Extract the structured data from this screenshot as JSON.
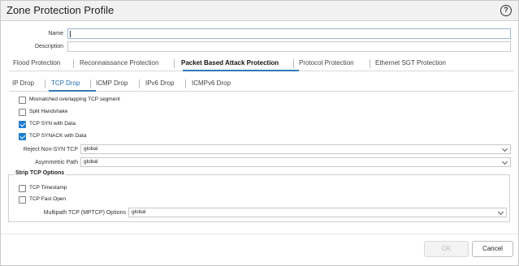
{
  "dialog": {
    "title": "Zone Protection Profile",
    "help_icon": "?"
  },
  "form": {
    "name_label": "Name",
    "name_value": "",
    "description_label": "Description",
    "description_value": ""
  },
  "main_tabs": [
    {
      "label": "Flood Protection",
      "active": false
    },
    {
      "label": "Reconnaissance Protection",
      "active": false
    },
    {
      "label": "Packet Based Attack Protection",
      "active": true
    },
    {
      "label": "Protocol Protection",
      "active": false
    },
    {
      "label": "Ethernet SGT Protection",
      "active": false
    }
  ],
  "sub_tabs": [
    {
      "label": "IP Drop",
      "active": false
    },
    {
      "label": "TCP Drop",
      "active": true
    },
    {
      "label": "ICMP Drop",
      "active": false
    },
    {
      "label": "IPv6 Drop",
      "active": false
    },
    {
      "label": "ICMPv6 Drop",
      "active": false
    }
  ],
  "tcp_drop": {
    "checkboxes": [
      {
        "label": "Mismatched overlapping TCP segment",
        "checked": false
      },
      {
        "label": "Split Handshake",
        "checked": false
      },
      {
        "label": "TCP SYN with Data",
        "checked": true
      },
      {
        "label": "TCP SYNACK with Data",
        "checked": true
      }
    ],
    "reject_non_syn": {
      "label": "Reject Non-SYN TCP",
      "value": "global"
    },
    "asymmetric_path": {
      "label": "Asymmetric Path",
      "value": "global"
    },
    "strip_tcp_options": {
      "legend": "Strip TCP Options",
      "checkboxes": [
        {
          "label": "TCP Timestamp",
          "checked": false
        },
        {
          "label": "TCP Fast Open",
          "checked": false
        }
      ],
      "mptcp": {
        "label": "Multipath TCP (MPTCP) Options",
        "value": "global"
      }
    }
  },
  "footer": {
    "ok_label": "OK",
    "cancel_label": "Cancel"
  }
}
